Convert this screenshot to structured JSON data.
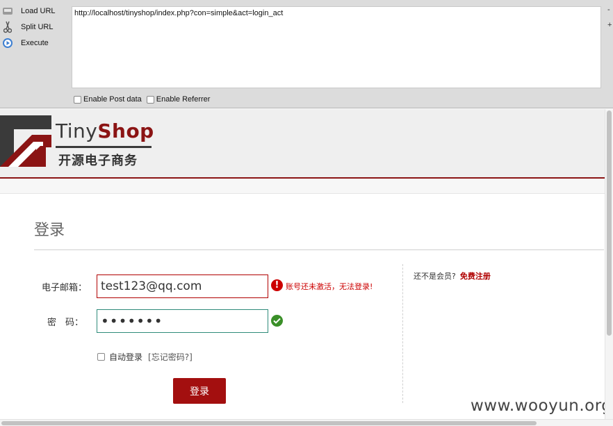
{
  "toolbar": {
    "load_url": "Load URL",
    "split_url": "Split URL",
    "execute": "Execute",
    "url_value": "http://localhost/tinyshop/index.php?con=simple&act=login_act",
    "enable_post": "Enable Post data",
    "enable_referrer": "Enable Referrer",
    "side_minus": "-",
    "side_plus": "+"
  },
  "logo": {
    "brand_a": "Tiny",
    "brand_b": "Shop",
    "subtitle": "开源电子商务"
  },
  "login": {
    "title": "登录",
    "email_label": "电子邮箱：",
    "email_value": "test123@qq.com",
    "error_message": "账号还未激活，无法登录!",
    "password_label": "密　码：",
    "password_value": "•••••••",
    "remember_label": "自动登录",
    "forgot_label": "[忘记密码?]",
    "submit_label": "登录"
  },
  "sidebar": {
    "not_member": "还不是会员?",
    "register": "免费注册"
  },
  "watermark": "www.wooyun.org",
  "colors": {
    "accent": "#a30f0f",
    "error": "#cc0000",
    "success": "#3a8f28"
  }
}
